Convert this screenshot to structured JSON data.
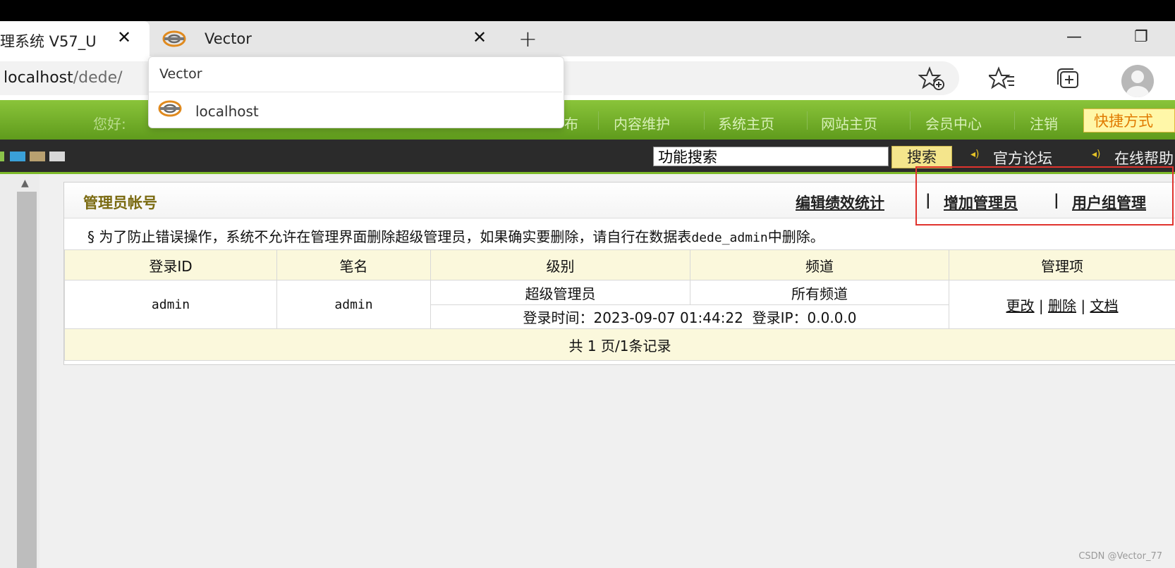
{
  "browser": {
    "tabs": [
      {
        "title": "理系统 V57_U",
        "active": true
      },
      {
        "title": "Vector",
        "active": false
      }
    ],
    "close_glyph": "✕",
    "new_tab_glyph": "+",
    "minimize_glyph": "—",
    "restore_glyph": "❐",
    "url_main": "localhost",
    "url_path": "/dede/",
    "tooltip": {
      "title": "Vector",
      "host": "localhost"
    }
  },
  "cms_nav": {
    "greeting": "您好:",
    "partial_item": "布",
    "items": [
      "内容维护",
      "系统主页",
      "网站主页",
      "会员中心",
      "注销"
    ],
    "quick_label": "快捷方式"
  },
  "toolbar": {
    "search_value": "功能搜索",
    "search_button": "搜索",
    "links": [
      "官方论坛",
      "在线帮助"
    ]
  },
  "panel": {
    "title": "管理员帐号",
    "header_links": [
      "编辑绩效统计",
      "增加管理员",
      "用户组管理"
    ],
    "separator": "|",
    "notice_prefix": "§ 为了防止错误操作，系统不允许在管理界面删除超级管理员，如果确实要删除，请自行在数据表",
    "notice_table": "dede_admin",
    "notice_suffix": "中删除。"
  },
  "table": {
    "headers": [
      "登录ID",
      "笔名",
      "级别",
      "频道",
      "管理项"
    ],
    "rows": [
      {
        "login_id": "admin",
        "pen_name": "admin",
        "level": "超级管理员",
        "channel": "所有频道",
        "login_info": "登录时间：2023-09-07 01:44:22  登录IP：0.0.0.0",
        "actions": [
          "更改",
          "删除",
          "文档"
        ]
      }
    ],
    "pager": "共 1 页/1条记录"
  },
  "watermark": "CSDN @Vector_77",
  "colors": {
    "nav_green": "#6fae24",
    "dark_bar": "#2b2b2b",
    "highlight_red": "#e0332e",
    "table_header_bg": "#fbf8dc"
  },
  "icons": [
    "dedecms-logo-icon",
    "close-icon",
    "plus-icon",
    "minimize-icon",
    "restore-icon",
    "add-favorite-icon",
    "favorites-icon",
    "collections-icon",
    "profile-icon",
    "speaker-icon"
  ]
}
